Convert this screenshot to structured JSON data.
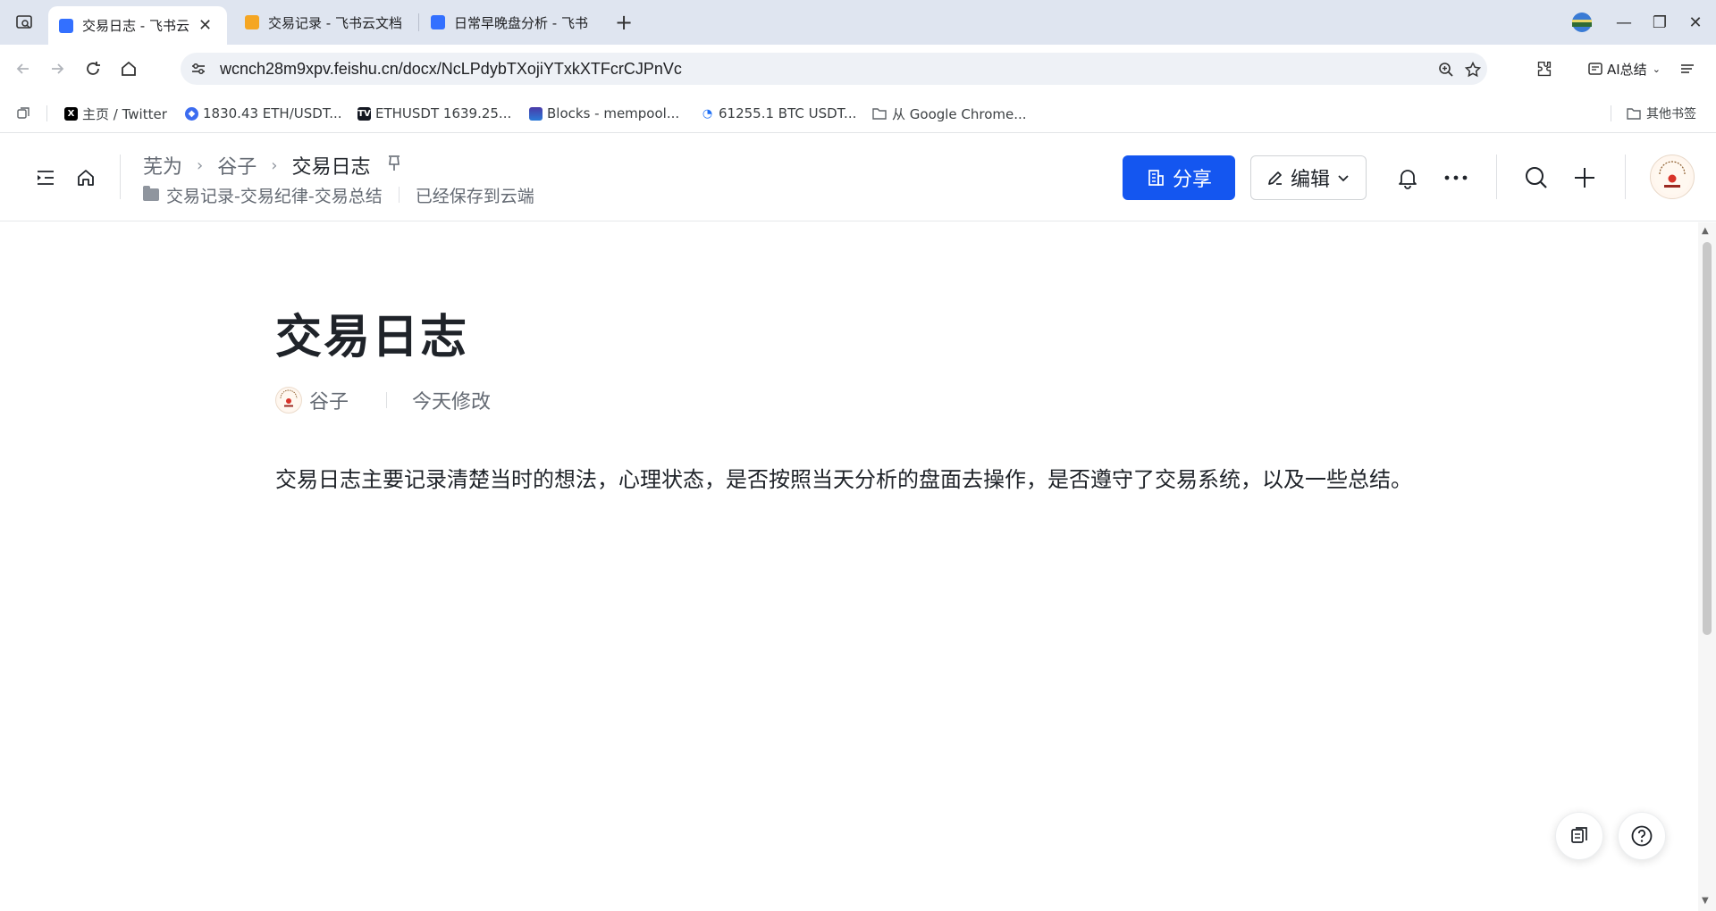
{
  "browser": {
    "tabs": [
      {
        "title": "交易日志 - 飞书云",
        "active": true,
        "favicon_color": "#3370ff"
      },
      {
        "title": "交易记录 - 飞书云文档",
        "active": false,
        "favicon_color": "#f5a623"
      },
      {
        "title": "日常早晚盘分析 - 飞书",
        "active": false,
        "favicon_color": "#3370ff"
      }
    ],
    "url": "wcnch28m9xpv.feishu.cn/docx/NcLPdybTXojiYTxkXTFcrCJPnVc",
    "ai_summary_label": "AI总结",
    "bookmarks": [
      {
        "label": "主页 / Twitter",
        "icon": "x-logo-icon",
        "color": "#000000"
      },
      {
        "label": "1830.43 ETH/USDT...",
        "icon": "binance-icon",
        "color": "#3c6cf0"
      },
      {
        "label": "ETHUSDT 1639.25...",
        "icon": "tradingview-icon",
        "color": "#131722"
      },
      {
        "label": "Blocks - mempool...",
        "icon": "mempool-icon",
        "color": "#4a3aa8"
      },
      {
        "label": "61255.1 BTC USDT...",
        "icon": "okx-icon",
        "color": "#1e6ff5"
      },
      {
        "label": "从 Google Chrome...",
        "icon": "folder-icon",
        "color": "#5f6368"
      }
    ],
    "other_bookmarks_label": "其他书签"
  },
  "header": {
    "breadcrumb": [
      "芜为",
      "谷子",
      "交易日志"
    ],
    "folder_path": "交易记录-交易纪律-交易总结",
    "save_status": "已经保存到云端",
    "share_label": "分享",
    "edit_label": "编辑"
  },
  "doc": {
    "title": "交易日志",
    "author": "谷子",
    "modified": "今天修改",
    "body": "交易日志主要记录清楚当时的想法，心理状态，是否按照当天分析的盘面去操作，是否遵守了交易系统，以及一些总结。"
  },
  "colors": {
    "accent": "#1456f0",
    "text": "#1f2329",
    "muted": "#646a73"
  }
}
